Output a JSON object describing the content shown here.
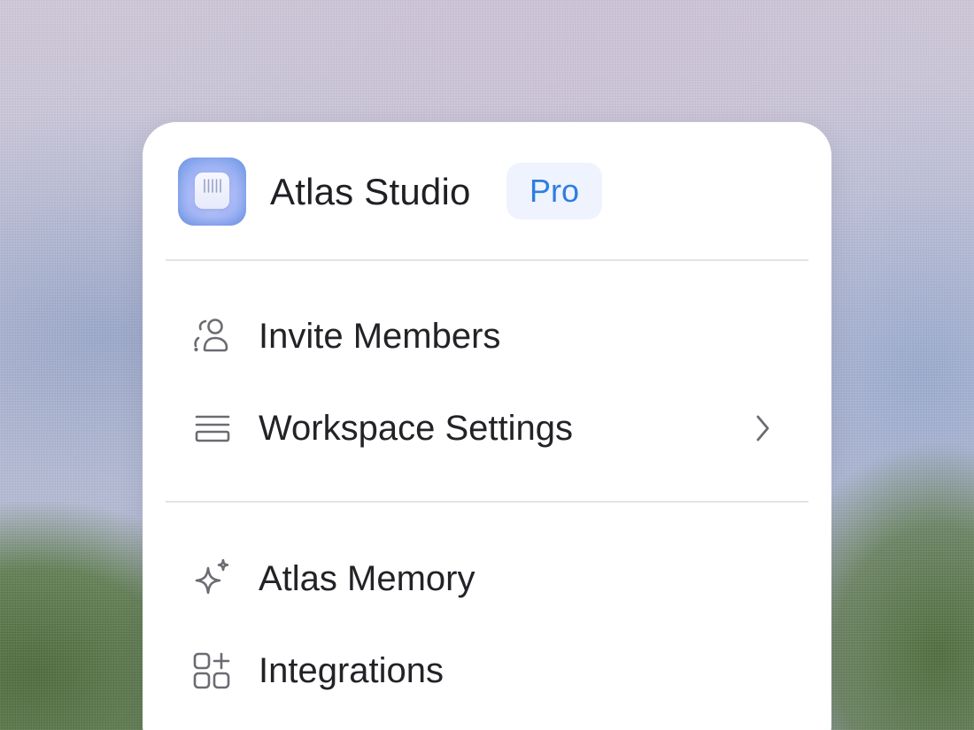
{
  "header": {
    "app_name": "Atlas Studio",
    "plan_badge": "Pro",
    "app_icon": "atlas-app-icon"
  },
  "menu": {
    "section1": [
      {
        "label": "Invite Members",
        "icon": "person-add-icon",
        "has_submenu": false
      },
      {
        "label": "Workspace Settings",
        "icon": "settings-lines-icon",
        "has_submenu": true
      }
    ],
    "section2": [
      {
        "label": "Atlas Memory",
        "icon": "sparkle-icon",
        "has_submenu": false
      },
      {
        "label": "Integrations",
        "icon": "grid-plus-icon",
        "has_submenu": false
      }
    ]
  },
  "colors": {
    "accent": "#2f7de0",
    "badge_bg": "#eef3fd",
    "text": "#222227",
    "icon": "#6b6b72",
    "divider": "#e3e3e6"
  }
}
